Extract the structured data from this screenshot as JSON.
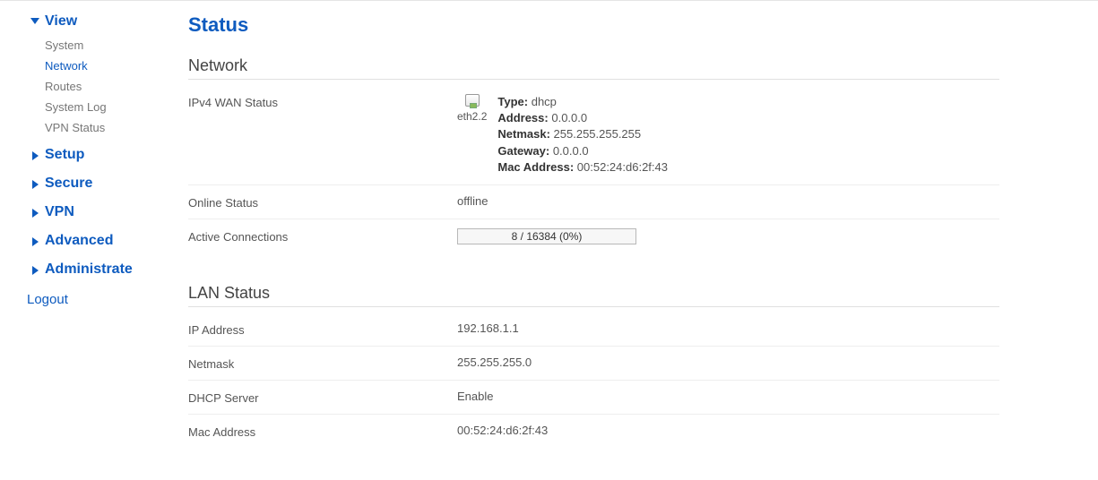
{
  "nav": {
    "view": {
      "label": "View",
      "expanded": true,
      "items": [
        {
          "label": "System"
        },
        {
          "label": "Network",
          "active": true
        },
        {
          "label": "Routes"
        },
        {
          "label": "System Log"
        },
        {
          "label": "VPN Status"
        }
      ]
    },
    "sections": [
      {
        "label": "Setup"
      },
      {
        "label": "Secure"
      },
      {
        "label": "VPN"
      },
      {
        "label": "Advanced"
      },
      {
        "label": "Administrate"
      }
    ],
    "logout": "Logout"
  },
  "page": {
    "title": "Status"
  },
  "network": {
    "heading": "Network",
    "wan": {
      "label": "IPv4 WAN Status",
      "iface": "eth2.2",
      "type_label": "Type:",
      "type": "dhcp",
      "address_label": "Address:",
      "address": "0.0.0.0",
      "netmask_label": "Netmask:",
      "netmask": "255.255.255.255",
      "gateway_label": "Gateway:",
      "gateway": "0.0.0.0",
      "mac_label": "Mac Address:",
      "mac": "00:52:24:d6:2f:43"
    },
    "online": {
      "label": "Online Status",
      "value": "offline"
    },
    "connections": {
      "label": "Active Connections",
      "text": "8 / 16384 (0%)",
      "percent": 0
    }
  },
  "lan": {
    "heading": "LAN Status",
    "rows": {
      "ip_label": "IP Address",
      "ip": "192.168.1.1",
      "netmask_label": "Netmask",
      "netmask": "255.255.255.0",
      "dhcp_label": "DHCP Server",
      "dhcp": "Enable",
      "mac_label": "Mac Address",
      "mac": "00:52:24:d6:2f:43"
    }
  }
}
